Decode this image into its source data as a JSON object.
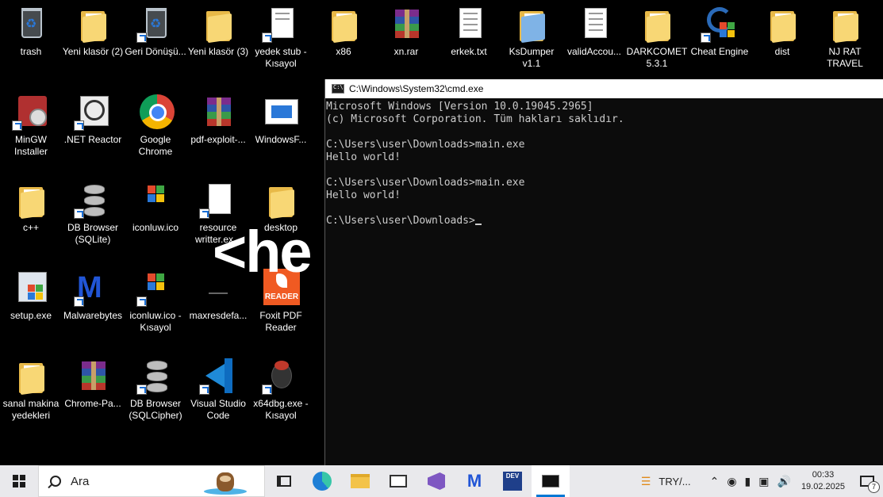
{
  "desktop": {
    "icons": [
      {
        "label": "trash"
      },
      {
        "label": "Yeni klasör (2)"
      },
      {
        "label": "Geri Dönüşü..."
      },
      {
        "label": "Yeni klasör (3)"
      },
      {
        "label": "yedek stub - Kısayol"
      },
      {
        "label": "x86"
      },
      {
        "label": "xn.rar"
      },
      {
        "label": "erkek.txt"
      },
      {
        "label": "KsDumper v1.1"
      },
      {
        "label": "validAccou..."
      },
      {
        "label": "DARKCOMET 5.3.1"
      },
      {
        "label": "Cheat Engine"
      },
      {
        "label": "dist"
      },
      {
        "label": "NJ RAT TRAVEL"
      },
      {
        "label": "MinGW Installer"
      },
      {
        "label": ".NET Reactor"
      },
      {
        "label": "Google Chrome"
      },
      {
        "label": "pdf-exploit-..."
      },
      {
        "label": "WindowsF..."
      },
      {
        "label": "c++"
      },
      {
        "label": "DB Browser (SQLite)"
      },
      {
        "label": "iconluw.ico"
      },
      {
        "label": "resource writter.ex..."
      },
      {
        "label": "desktop"
      },
      {
        "label": "setup.exe"
      },
      {
        "label": "Malwarebytes"
      },
      {
        "label": "iconluw.ico - Kısayol"
      },
      {
        "label": "maxresdefa..."
      },
      {
        "label": "Foxit PDF Reader"
      },
      {
        "label": "sanal makina yedekleri"
      },
      {
        "label": "Chrome-Pa..."
      },
      {
        "label": "DB Browser (SQLCipher)"
      },
      {
        "label": "Visual Studio Code"
      },
      {
        "label": "x64dbg.exe - Kısayol"
      }
    ],
    "overlay_text": "<he"
  },
  "cmd": {
    "title": "C:\\Windows\\System32\\cmd.exe",
    "lines": [
      "Microsoft Windows [Version 10.0.19045.2965]",
      "(c) Microsoft Corporation. Tüm hakları saklıdır.",
      "",
      "C:\\Users\\user\\Downloads>main.exe",
      "Hello world!",
      "",
      "C:\\Users\\user\\Downloads>main.exe",
      "Hello world!",
      "",
      "C:\\Users\\user\\Downloads>"
    ]
  },
  "taskbar": {
    "search_placeholder": "Ara",
    "tray_label": "TRY/...",
    "time": "00:33",
    "date": "19.02.2025",
    "notification_count": "7"
  },
  "colors": {
    "accent": "#0078d4",
    "cmd_bg": "#0c0c0c",
    "cmd_fg": "#cccccc",
    "taskbar_bg": "#e9e9ec"
  }
}
